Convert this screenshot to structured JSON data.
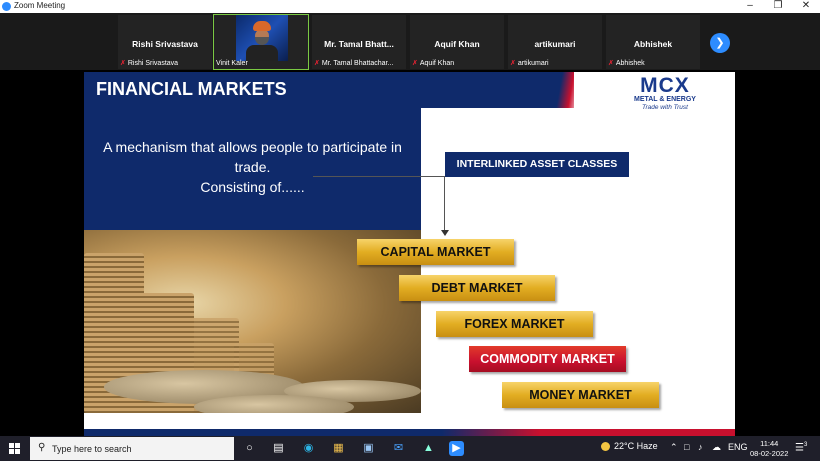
{
  "window": {
    "title": "Zoom Meeting"
  },
  "participants": [
    {
      "name": "Rishi Srivastava",
      "label": "Rishi Srivastava"
    },
    {
      "name": "",
      "label": "Vinit Kaler"
    },
    {
      "name": "Mr. Tamal Bhatt...",
      "label": "Mr. Tamal Bhattachar..."
    },
    {
      "name": "Aquif Khan",
      "label": "Aquif Khan"
    },
    {
      "name": "artikumari",
      "label": "artikumari"
    },
    {
      "name": "Abhishek",
      "label": "Abhishek"
    }
  ],
  "slide": {
    "title": "FINANCIAL MARKETS",
    "logo": {
      "name": "MCX",
      "subtitle": "METAL & ENERGY",
      "tagline": "Trade with Trust"
    },
    "description_line1": "A mechanism that allows people to participate in",
    "description_line2": "trade.",
    "description_line3": "Consisting of......",
    "asset_classes_label": "INTERLINKED ASSET CLASSES",
    "markets": [
      "CAPITAL MARKET",
      "DEBT MARKET",
      "FOREX MARKET",
      "COMMODITY MARKET",
      "MONEY MARKET"
    ]
  },
  "taskbar": {
    "search_placeholder": "Type here to search",
    "weather": "22°C  Haze",
    "language": "ENG",
    "time": "11:44",
    "date": "08-02-2022",
    "notification_count": "3"
  },
  "colors": {
    "navy": "#0f2a6b",
    "red": "#c8102e",
    "gold": "#e2ad22",
    "zoom_blue": "#2d8cff"
  }
}
